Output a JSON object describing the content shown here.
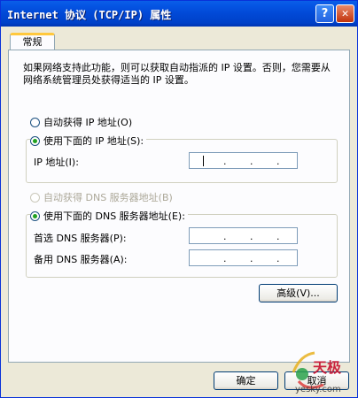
{
  "window": {
    "title": "Internet 协议 (TCP/IP) 属性",
    "help_glyph": "?",
    "close_glyph": "✕"
  },
  "tabs": [
    {
      "label": "常规"
    }
  ],
  "description": "如果网络支持此功能，则可以获取自动指派的 IP 设置。否则，您需要从网络系统管理员处获得适当的 IP 设置。",
  "ip": {
    "auto_label": "自动获得 IP 地址(O)",
    "manual_label": "使用下面的 IP 地址(S):",
    "selected": "manual",
    "address_label": "IP 地址(I):",
    "address_value": ""
  },
  "dns": {
    "auto_label": "自动获得 DNS 服务器地址(B)",
    "manual_label": "使用下面的 DNS 服务器地址(E):",
    "selected": "manual",
    "auto_disabled": true,
    "preferred_label": "首选 DNS 服务器(P):",
    "alternate_label": "备用 DNS 服务器(A):",
    "preferred_value": "",
    "alternate_value": ""
  },
  "buttons": {
    "advanced": "高级(V)...",
    "ok": "确定",
    "cancel": "取消"
  },
  "ip_separator": ".",
  "watermark": {
    "brand": "天极",
    "url": "yesky.com"
  }
}
